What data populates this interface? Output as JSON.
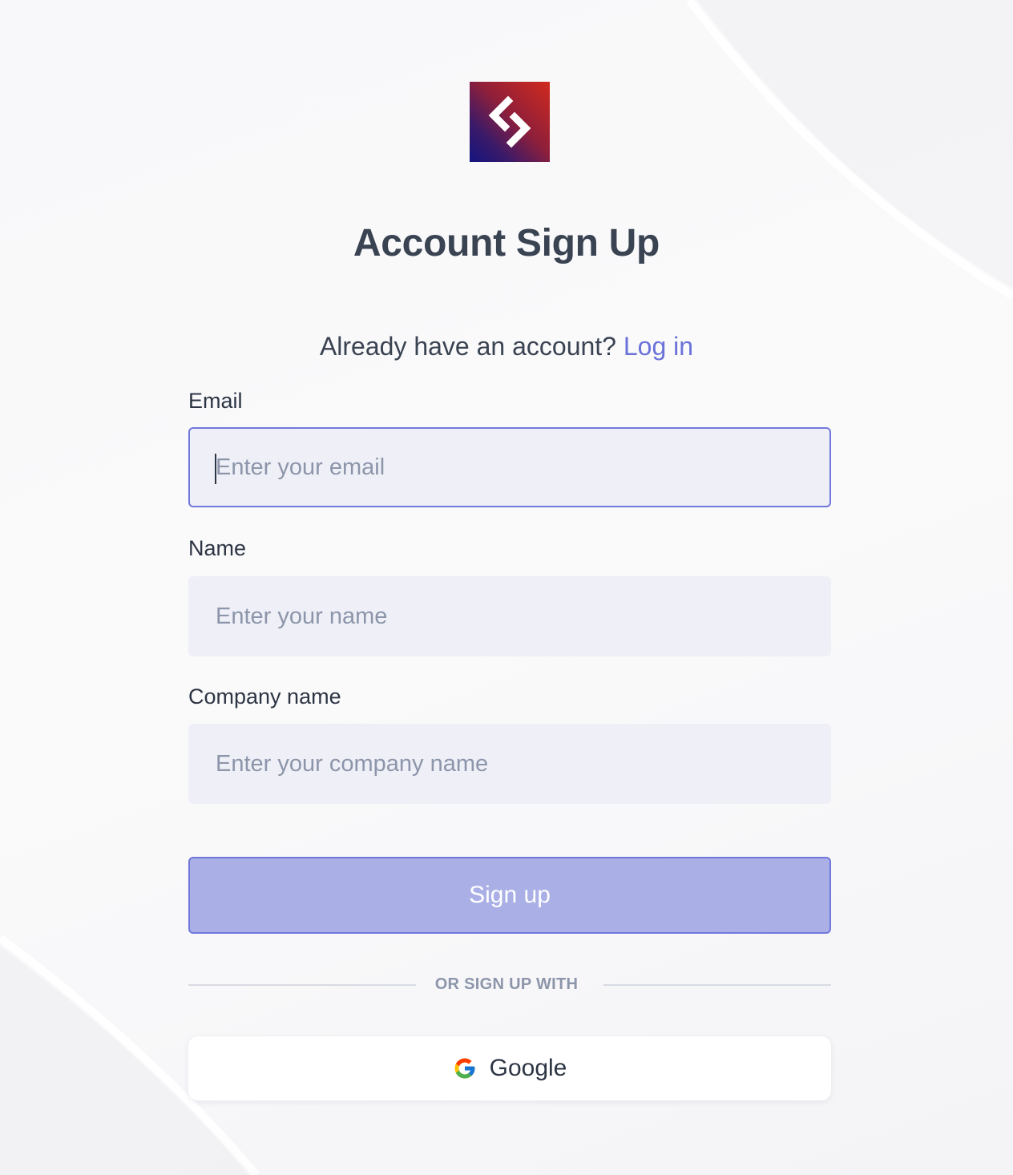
{
  "title": "Account Sign Up",
  "login_prompt": {
    "text": "Already have an account?",
    "link": "Log in"
  },
  "form": {
    "email": {
      "label": "Email",
      "placeholder": "Enter your email"
    },
    "name": {
      "label": "Name",
      "placeholder": "Enter your name"
    },
    "company": {
      "label": "Company name",
      "placeholder": "Enter your company name"
    }
  },
  "signup_button": "Sign up",
  "divider_text": "OR SIGN UP WITH",
  "google_button": {
    "label": "Google",
    "icon": "google-icon"
  },
  "logo": {
    "icon": "brand-logo-icon"
  },
  "colors": {
    "accent": "#6a72d9",
    "button_fill": "#aab0e6",
    "input_bg": "#eff0f7",
    "text": "#2d3544",
    "placeholder": "#8c95aa"
  }
}
